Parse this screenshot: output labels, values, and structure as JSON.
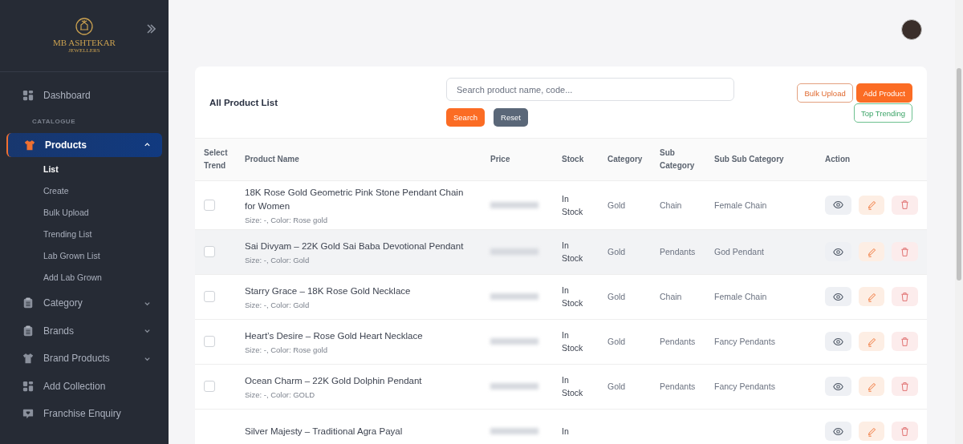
{
  "sidebar": {
    "logo": {
      "line1": "MB ASHTEKAR",
      "line2": "JEWELLERS"
    },
    "items": [
      {
        "kind": "link",
        "label": "Dashboard",
        "selected": false
      },
      {
        "kind": "section",
        "label": "CATALOGUE"
      },
      {
        "kind": "menu",
        "label": "Products",
        "selected": true,
        "expanded": true,
        "children": [
          {
            "label": "List",
            "selected": true
          },
          {
            "label": "Create",
            "selected": false
          },
          {
            "label": "Bulk Upload",
            "selected": false
          },
          {
            "label": "Trending List",
            "selected": false
          },
          {
            "label": "Lab Grown List",
            "selected": false
          },
          {
            "label": "Add Lab Grown",
            "selected": false
          }
        ]
      },
      {
        "kind": "menu",
        "label": "Category",
        "selected": false,
        "expanded": false
      },
      {
        "kind": "menu",
        "label": "Brands",
        "selected": false,
        "expanded": false
      },
      {
        "kind": "menu",
        "label": "Brand Products",
        "selected": false,
        "expanded": false
      },
      {
        "kind": "link",
        "label": "Add Collection",
        "selected": false
      },
      {
        "kind": "link",
        "label": "Franchise Enquiry",
        "selected": false
      }
    ]
  },
  "card": {
    "title": "All Product List",
    "search": {
      "placeholder": "Search product name, code..."
    },
    "buttons": [
      {
        "kind": "primary",
        "label": "Search"
      },
      {
        "kind": "secondary",
        "label": "Reset"
      }
    ],
    "actions": [
      {
        "kind": "outline-orange",
        "label": "Bulk Upload"
      },
      {
        "kind": "primary",
        "label": "Add Product"
      },
      {
        "kind": "outline-green",
        "label": "Top Trending"
      }
    ]
  },
  "table": {
    "columns": [
      "Select Trend",
      "Product Name",
      "Price",
      "Stock",
      "Category",
      "Sub Category",
      "Sub Sub Category",
      "Action"
    ],
    "rows": [
      {
        "checked": false,
        "highlighted": false,
        "name": "18K Rose Gold Geometric Pink Stone Pendant Chain for Women",
        "details": "Size: -, Color: Rose gold",
        "stock": "In Stock",
        "category": "Gold",
        "sub_category": "Chain",
        "sub_sub_category": "Female Chain"
      },
      {
        "checked": false,
        "highlighted": true,
        "name": "Sai Divyam – 22K Gold Sai Baba Devotional Pendant",
        "details": "Size: -, Color: Gold",
        "stock": "In Stock",
        "category": "Gold",
        "sub_category": "Pendants",
        "sub_sub_category": "God Pendant"
      },
      {
        "checked": false,
        "highlighted": false,
        "name": "Starry Grace – 18K Rose Gold Necklace",
        "details": "Size: -, Color: Gold",
        "stock": "In Stock",
        "category": "Gold",
        "sub_category": "Chain",
        "sub_sub_category": "Female Chain"
      },
      {
        "checked": false,
        "highlighted": false,
        "name": "Heart’s Desire – Rose Gold Heart Necklace",
        "details": "Size: -, Color: Rose gold",
        "stock": "In Stock",
        "category": "Gold",
        "sub_category": "Pendants",
        "sub_sub_category": "Fancy Pendants"
      },
      {
        "checked": false,
        "highlighted": false,
        "name": "Ocean Charm – 22K Gold Dolphin Pendant",
        "details": "Size: -, Color: GOLD",
        "stock": "In Stock",
        "category": "Gold",
        "sub_category": "Pendants",
        "sub_sub_category": "Fancy Pendants"
      },
      {
        "highlighted": false,
        "name": "Silver Majesty – Traditional Agra Payal",
        "stock": "In"
      }
    ]
  }
}
